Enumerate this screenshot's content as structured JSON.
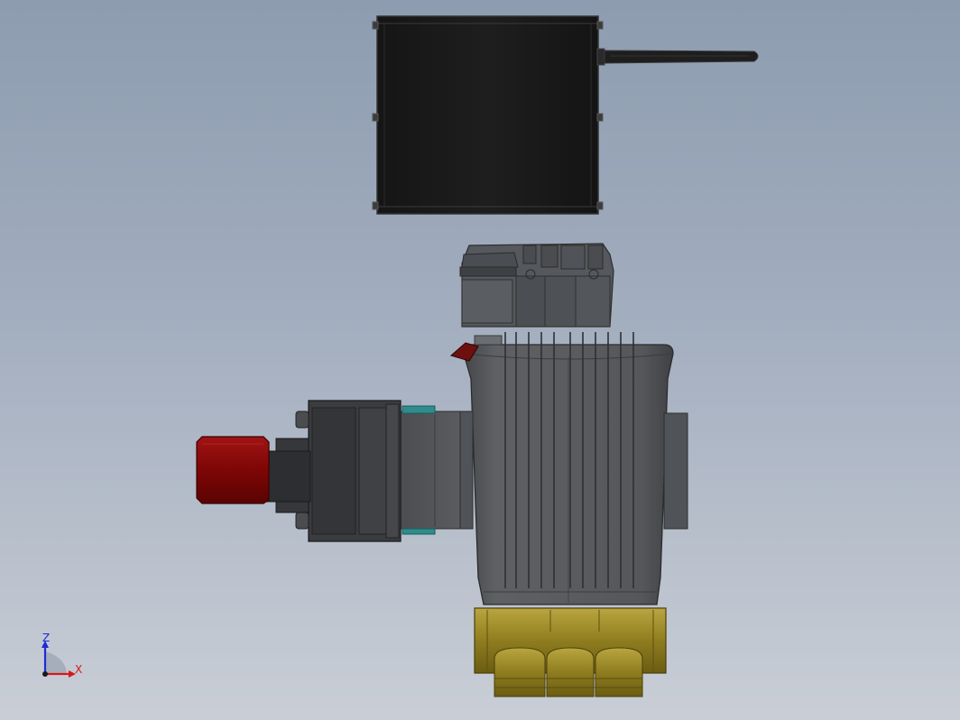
{
  "triad": {
    "z_label": "Z",
    "x_label": "X",
    "colors": {
      "z": "#1a2bd6",
      "x": "#d61a1a",
      "origin": "#1a1a1a"
    }
  },
  "colors": {
    "background_top": "#8d9cb0",
    "background_bottom": "#c9ced6",
    "controller_box": "#1c1c1c",
    "motor_body": "#56585b",
    "brass_manifold": "#9c8a2a",
    "red_cap": "#8b0a0a",
    "teal_accent": "#2e8c8c"
  }
}
